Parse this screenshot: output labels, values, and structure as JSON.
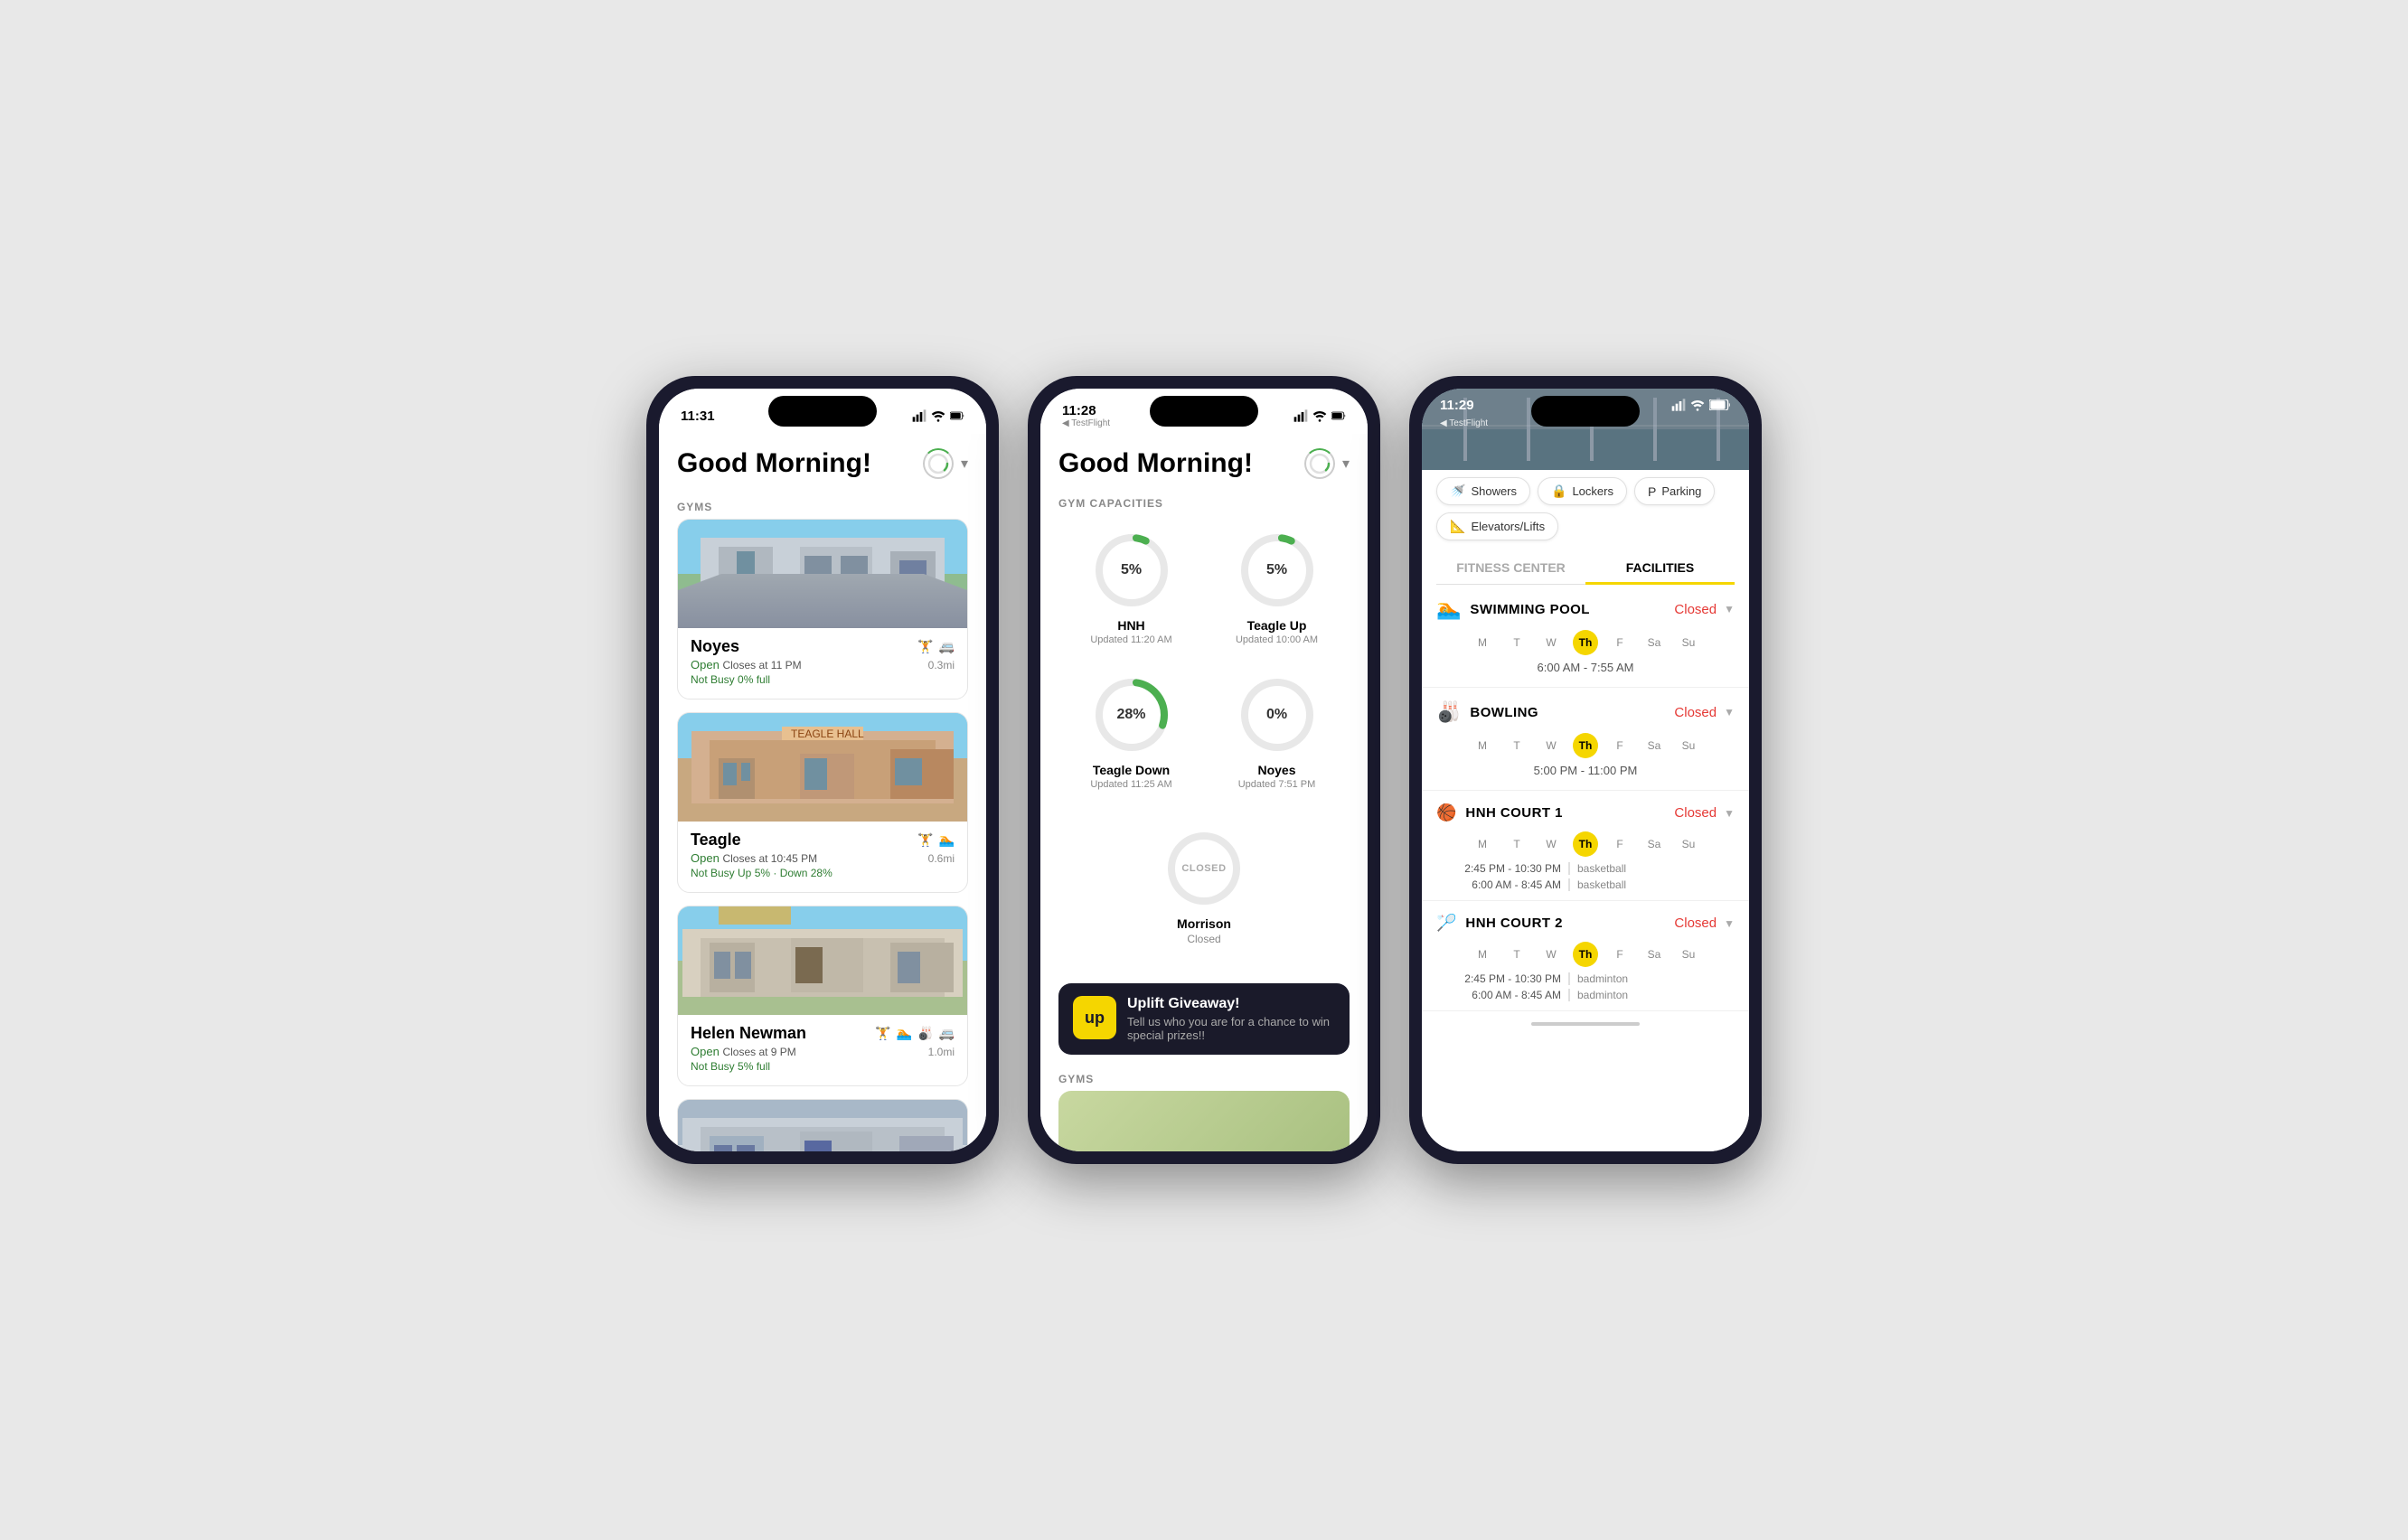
{
  "phone1": {
    "status_time": "11:31",
    "greeting": "Good Morning!",
    "section_gyms": "GYMS",
    "gyms": [
      {
        "name": "Noyes",
        "status": "Open  Closes at 11 PM",
        "busy": "Not Busy  0% full",
        "distance": "0.3mi",
        "img_class": "img-noyes",
        "icons": "🏋 🚐"
      },
      {
        "name": "Teagle",
        "status": "Open  Closes at 10:45 PM",
        "busy": "Not Busy  Up 5% · Down 28%",
        "distance": "0.6mi",
        "img_class": "img-teagle",
        "icons": "🏋 🏊"
      },
      {
        "name": "Helen Newman",
        "status": "Open  Closes at 9 PM",
        "busy": "Not Busy  5% full",
        "distance": "1.0mi",
        "img_class": "img-helen",
        "icons": "🏋 🏊 🎳 🚐"
      },
      {
        "name": "",
        "status": "",
        "busy": "",
        "distance": "",
        "img_class": "img-4th",
        "icons": ""
      }
    ]
  },
  "phone2": {
    "status_time": "11:28",
    "greeting": "Good Morning!",
    "section_capacities": "GYM CAPACITIES",
    "capacities": [
      {
        "name": "HNH",
        "value": "5%",
        "updated": "Updated 11:20 AM",
        "pct": 5,
        "closed": false
      },
      {
        "name": "Teagle Up",
        "value": "5%",
        "updated": "Updated 10:00 AM",
        "pct": 5,
        "closed": false
      },
      {
        "name": "Teagle Down",
        "value": "28%",
        "updated": "Updated 11:25 AM",
        "pct": 28,
        "closed": false
      },
      {
        "name": "Noyes",
        "value": "0%",
        "updated": "Updated 7:51 PM",
        "pct": 0,
        "closed": false
      },
      {
        "name": "Morrison",
        "value": "CLOSED",
        "updated": "Closed",
        "pct": 0,
        "closed": true
      }
    ],
    "uplift_title": "Uplift Giveaway!",
    "uplift_desc": "Tell us who you are for a chance to win special prizes!!",
    "uplift_logo": "up",
    "section_gyms": "GYMS"
  },
  "phone3": {
    "status_time": "11:29",
    "testflight": "◀ TestFlight",
    "top_tabs": [
      "Showers",
      "Lockers",
      "Parking",
      "Elevators/Lifts"
    ],
    "top_tab_icons": [
      "🚿",
      "🔒",
      "P",
      "📐"
    ],
    "main_tabs": [
      "FITNESS CENTER",
      "FACILITIES"
    ],
    "active_tab": 1,
    "facilities": [
      {
        "name": "SWIMMING POOL",
        "icon": "🏊",
        "status": "Closed",
        "days": [
          "M",
          "T",
          "W",
          "Th",
          "F",
          "Sa",
          "Su"
        ],
        "active_day": "Th",
        "times": [
          "6:00 AM - 7:55 AM"
        ],
        "time_tags": [
          ""
        ]
      },
      {
        "name": "BOWLING",
        "icon": "🎳",
        "status": "Closed",
        "days": [
          "M",
          "T",
          "W",
          "Th",
          "F",
          "Sa",
          "Su"
        ],
        "active_day": "Th",
        "times": [
          "5:00 PM - 11:00 PM"
        ],
        "time_tags": [
          ""
        ]
      },
      {
        "name": "HNH COURT 1",
        "icon": "🏀",
        "status": "Closed",
        "days": [
          "M",
          "T",
          "W",
          "Th",
          "F",
          "Sa",
          "Su"
        ],
        "active_day": "Th",
        "times": [
          "2:45 PM - 10:30 PM",
          "6:00 AM - 8:45 AM"
        ],
        "time_tags": [
          "basketball",
          "basketball"
        ]
      },
      {
        "name": "HNH COURT 2",
        "icon": "🏸",
        "status": "Closed",
        "days": [
          "M",
          "T",
          "W",
          "Th",
          "F",
          "Sa",
          "Su"
        ],
        "active_day": "Th",
        "times": [
          "2:45 PM - 10:30 PM",
          "6:00 AM - 8:45 AM"
        ],
        "time_tags": [
          "badminton",
          "badminton"
        ]
      }
    ]
  }
}
